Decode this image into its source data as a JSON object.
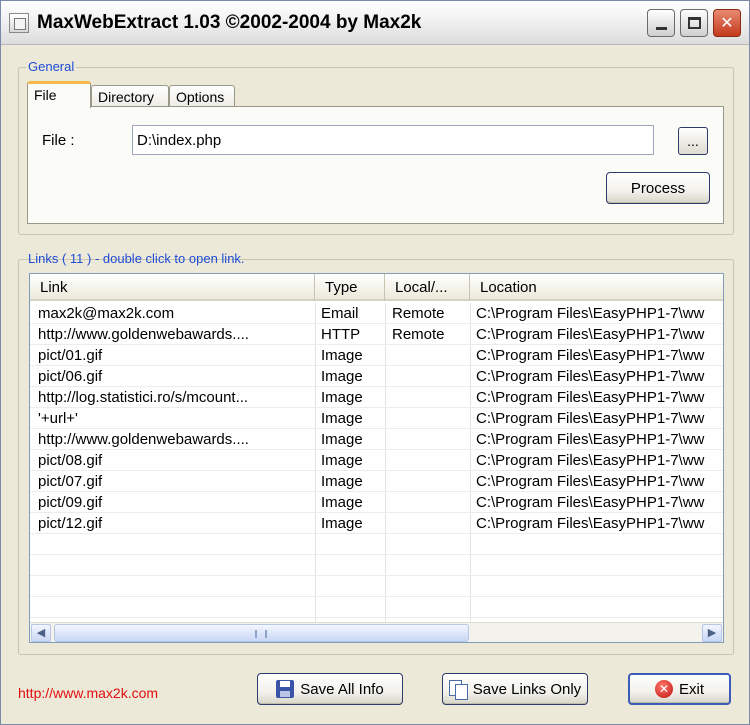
{
  "window": {
    "title": "MaxWebExtract 1.03 ©2002-2004 by Max2k"
  },
  "general": {
    "label": "General",
    "tabs": [
      {
        "label": "File",
        "active": true
      },
      {
        "label": "Directory",
        "active": false
      },
      {
        "label": "Options",
        "active": false
      }
    ],
    "file_label": "File :",
    "file_value": "D:\\index.php",
    "browse_label": "...",
    "process_label": "Process"
  },
  "links": {
    "caption": "Links ( 11 )  -   double click to open link.",
    "columns": [
      "Link",
      "Type",
      "Local/...",
      "Location"
    ],
    "rows": [
      [
        "max2k@max2k.com",
        "Email",
        "Remote",
        "C:\\Program Files\\EasyPHP1-7\\ww"
      ],
      [
        "http://www.goldenwebawards....",
        "HTTP",
        "Remote",
        "C:\\Program Files\\EasyPHP1-7\\ww"
      ],
      [
        "pict/01.gif",
        "Image",
        "",
        "C:\\Program Files\\EasyPHP1-7\\ww"
      ],
      [
        "pict/06.gif",
        "Image",
        "",
        "C:\\Program Files\\EasyPHP1-7\\ww"
      ],
      [
        "http://log.statistici.ro/s/mcount...",
        "Image",
        "",
        "C:\\Program Files\\EasyPHP1-7\\ww"
      ],
      [
        "'+url+'",
        "Image",
        "",
        "C:\\Program Files\\EasyPHP1-7\\ww"
      ],
      [
        "http://www.goldenwebawards....",
        "Image",
        "",
        "C:\\Program Files\\EasyPHP1-7\\ww"
      ],
      [
        "pict/08.gif",
        "Image",
        "",
        "C:\\Program Files\\EasyPHP1-7\\ww"
      ],
      [
        "pict/07.gif",
        "Image",
        "",
        "C:\\Program Files\\EasyPHP1-7\\ww"
      ],
      [
        "pict/09.gif",
        "Image",
        "",
        "C:\\Program Files\\EasyPHP1-7\\ww"
      ],
      [
        "pict/12.gif",
        "Image",
        "",
        "C:\\Program Files\\EasyPHP1-7\\ww"
      ]
    ]
  },
  "footer": {
    "url": "http://www.max2k.com",
    "save_all_label": "Save All Info",
    "save_links_label": "Save Links Only",
    "exit_label": "Exit"
  },
  "colors": {
    "accent": "#1f4bd8",
    "link": "#e01010",
    "close": "#c3391b"
  }
}
